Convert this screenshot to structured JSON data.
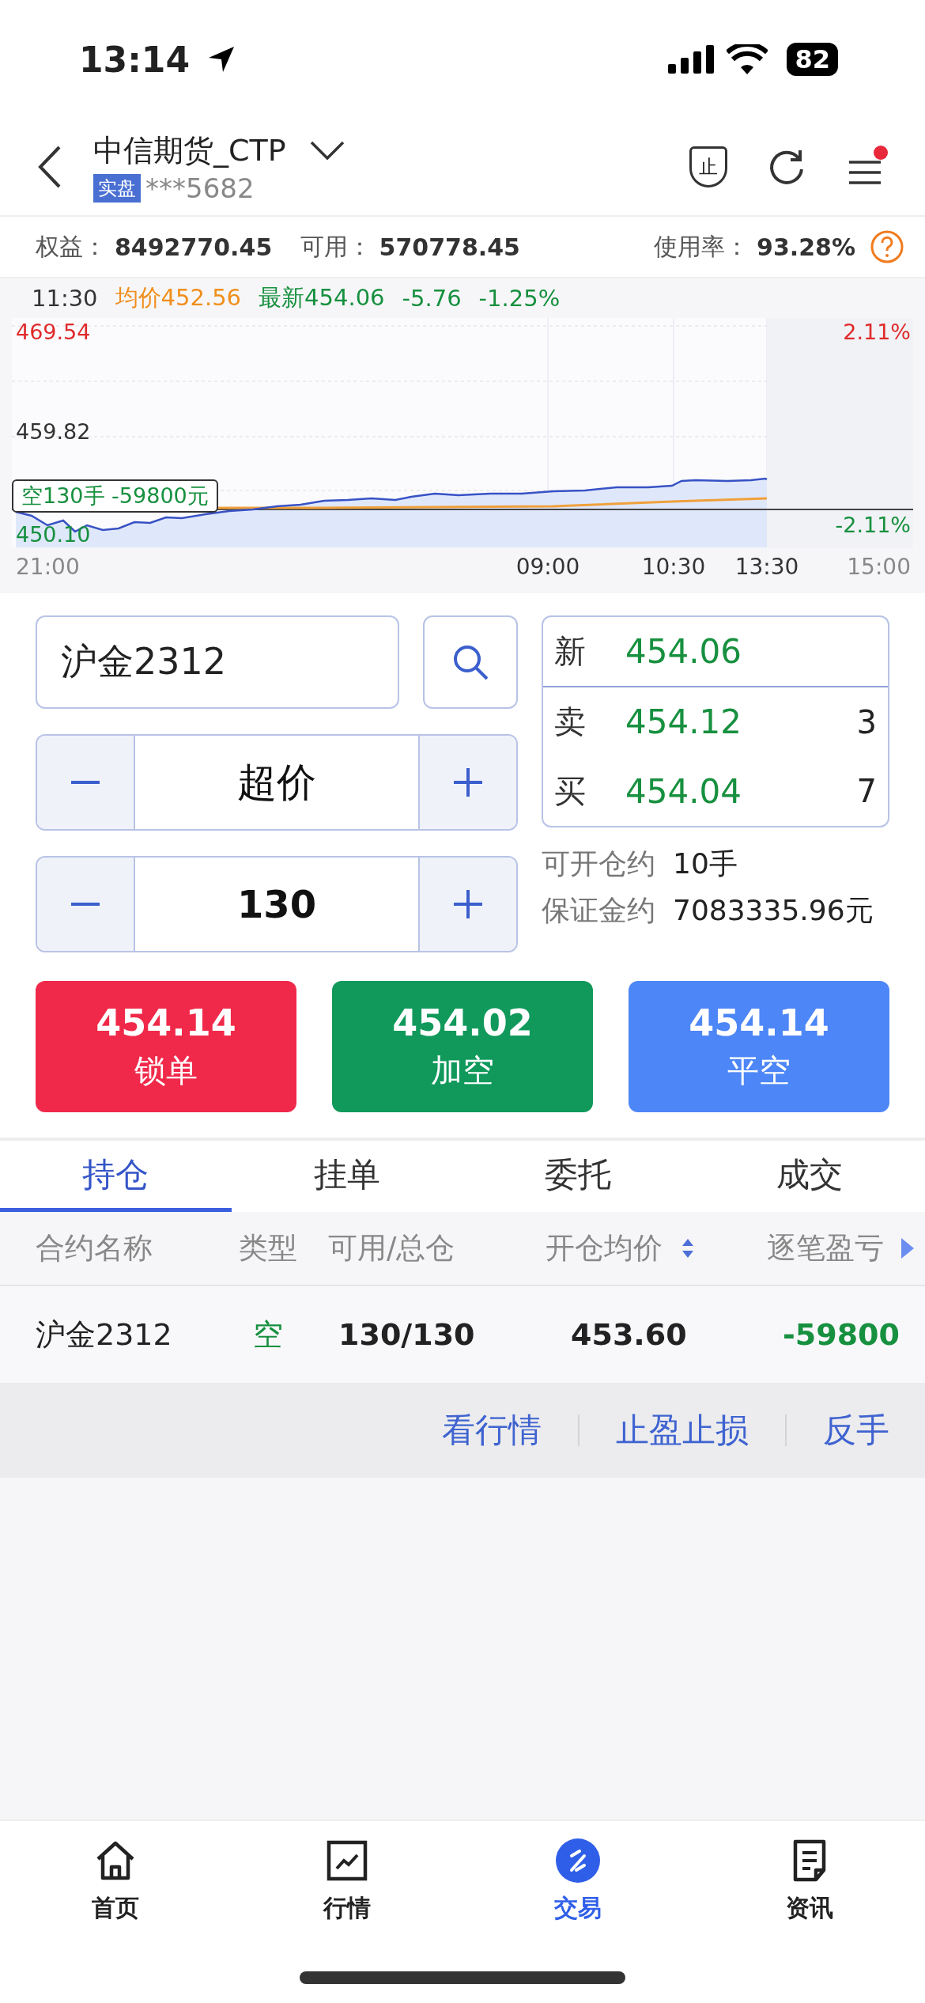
{
  "status_bar": {
    "time": "13:14",
    "battery": "82"
  },
  "header": {
    "title": "中信期货_CTP",
    "badge": "实盘",
    "account": "***5682",
    "guard_label": "止",
    "has_notification": true
  },
  "summary": [
    {
      "label": "权益：",
      "value": "8492770.45"
    },
    {
      "label": "可用：",
      "value": "570778.45"
    },
    {
      "label": "使用率：",
      "value": "93.28%"
    }
  ],
  "chart": {
    "time": "11:30",
    "average": "均价452.56",
    "latest": "最新454.06",
    "change": "-5.76",
    "change_percent": "-1.25%",
    "price_high": "469.54",
    "price_mid": "459.82",
    "price_low": "450.10",
    "percent_high": "2.11%",
    "percent_low": "-2.11%",
    "position_marker": "空130手 -59800元",
    "x_labels": [
      "21:00",
      "09:00",
      "10:30",
      "13:30",
      "15:00"
    ]
  },
  "order": {
    "contract": "沪金2312",
    "price_type": "超价",
    "quantity": "130"
  },
  "quote": [
    {
      "label": "新",
      "price": "454.06"
    },
    {
      "label": "卖",
      "price": "454.12",
      "volume": "3"
    },
    {
      "label": "买",
      "price": "454.04",
      "volume": "7"
    }
  ],
  "estimates": [
    {
      "label": "可开仓约",
      "value": "10手"
    },
    {
      "label": "保证金约",
      "value": "7083335.96元"
    }
  ],
  "action_buttons": [
    {
      "price": "454.14",
      "label": "锁单",
      "color": "#f0294a"
    },
    {
      "price": "454.02",
      "label": "加空",
      "color": "#10995b"
    },
    {
      "price": "454.14",
      "label": "平空",
      "color": "#4d86f6"
    }
  ],
  "tabs": [
    {
      "label": "持仓",
      "selected": true
    },
    {
      "label": "挂单",
      "selected": false
    },
    {
      "label": "委托",
      "selected": false
    },
    {
      "label": "成交",
      "selected": false
    }
  ],
  "table": {
    "columns": [
      "合约名称",
      "类型",
      "可用/总仓",
      "开仓均价",
      "逐笔盈亏"
    ],
    "rows": [
      {
        "cells": [
          "沪金2312",
          "空",
          "130/130",
          "453.60",
          "-59800"
        ],
        "expanded": true
      }
    ],
    "row_actions": [
      "看行情",
      "止盈止损",
      "反手"
    ]
  },
  "nav": [
    {
      "label": "首页",
      "selected": false
    },
    {
      "label": "行情",
      "selected": false
    },
    {
      "label": "交易",
      "selected": true
    },
    {
      "label": "资讯",
      "selected": false
    }
  ]
}
